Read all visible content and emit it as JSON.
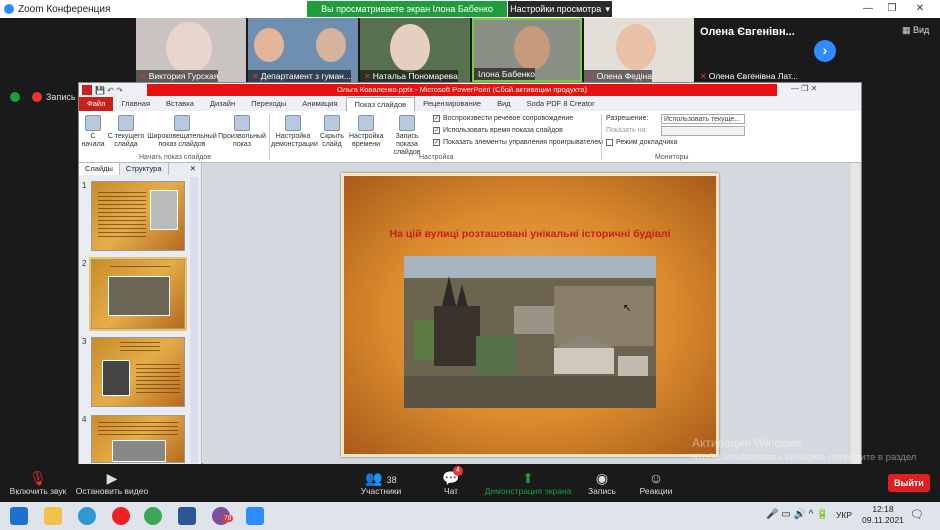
{
  "zoom": {
    "title": "Zoom Конференция",
    "share_banner": "Вы просматриваете экран Ілона Бабенко",
    "view_options": "Настройки просмотра",
    "view_button": "Вид",
    "participants": [
      {
        "name": "Виктория Гурская",
        "muted": true
      },
      {
        "name": "Департамент з гуман...",
        "muted": true
      },
      {
        "name": "Натальа Пономарева",
        "muted": true
      },
      {
        "name": "Ілона Бабенко",
        "muted": false
      },
      {
        "name": "Олена Федіна",
        "muted": true
      },
      {
        "name": "Олена Євгенівна Лат...",
        "muted": true
      }
    ],
    "big_name": "Олена Євгенівн...",
    "recording_label": "Запись",
    "toolbar": {
      "mute": "Включить звук",
      "video": "Остановить видео",
      "participants": "Участники",
      "participants_count": "38",
      "chat": "Чат",
      "chat_badge": "4",
      "share": "Демонстрация экрана",
      "record": "Запись",
      "reactions": "Реакции",
      "leave": "Выйти"
    }
  },
  "ppt": {
    "title": "Ольга Коваленко.pptx - Microsoft PowerPoint (Сбой активации продукта)",
    "tabs": [
      "Файл",
      "Главная",
      "Вставка",
      "Дизайн",
      "Переходы",
      "Анимация",
      "Показ слайдов",
      "Рецензирование",
      "Вид",
      "Soda PDF 8 Creator"
    ],
    "ribbon": {
      "from_start": "С начала",
      "from_current": "С текущего слайда",
      "broadcast": "Широковещательный показ слайдов",
      "custom": "Произвольный показ",
      "group_start": "Начать показ слайдов",
      "setup": "Настройка демонстрации",
      "hide": "Скрыть слайд",
      "rehearse": "Настройка времени",
      "record": "Запись показа слайдов",
      "chk_narration": "Воспроизвести речевое сопровождение",
      "chk_timing": "Использовать время показа слайдов",
      "chk_controls": "Показать элементы управления проигрывателем",
      "group_setup": "Настройка",
      "resolution_label": "Разрешение:",
      "resolution_value": "Использовать текуще...",
      "show_on_label": "Показать на:",
      "presenter_view": "Режим докладчика",
      "group_monitors": "Мониторы"
    },
    "panel_tabs": [
      "Слайды",
      "Структура"
    ],
    "slide_numbers": [
      "1",
      "2",
      "3",
      "4"
    ],
    "slide_title": "На цій вулиці розташовані унікальні історичні будівлі"
  },
  "windows": {
    "activation_title": "Активация Windows",
    "activation_text": "Чтобы активировать Windows, перейдите в раздел \"Параметры\".",
    "lang": "УКР",
    "time": "12:18",
    "date": "09.11.2021",
    "viber_badge": "78"
  }
}
